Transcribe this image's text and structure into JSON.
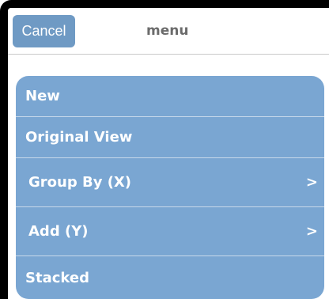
{
  "navbar": {
    "cancel_label": "Cancel",
    "title": "menu"
  },
  "menu": {
    "items": [
      {
        "label": "New",
        "has_submenu": false
      },
      {
        "label": "Original View",
        "has_submenu": false
      },
      {
        "label": "Group By (X)",
        "has_submenu": true,
        "chevron": ">"
      },
      {
        "label": "Add (Y)",
        "has_submenu": true,
        "chevron": ">"
      },
      {
        "label": "Stacked",
        "has_submenu": false
      }
    ]
  },
  "colors": {
    "frame": "#000000",
    "accent": "#6f9ac4",
    "menu_background": "#7aa6d2",
    "divider": "#c7d8ea",
    "title_text": "#6b6b6b"
  }
}
